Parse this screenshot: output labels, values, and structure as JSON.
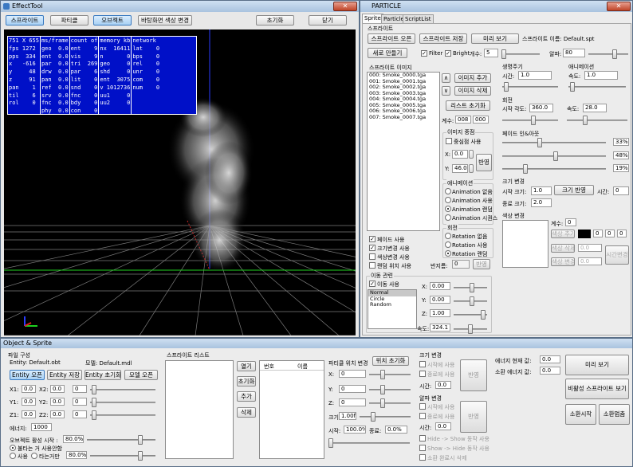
{
  "effect_tool": {
    "title": "EffectTool",
    "close": "✕",
    "toolbar": {
      "sprite": "스프라이트",
      "particle": "파티클",
      "object": "오브젝트",
      "bg_color": "바탕화면 색상 변경",
      "reset": "초기화",
      "close": "닫기"
    },
    "stats": [
      [
        "751 X 655",
        "fps 1272",
        "pps  334",
        "x   -616",
        "y     48",
        "z     91",
        "pan    1",
        "til    6",
        "rol    0"
      ],
      [
        "ms/frame",
        "geo  0.0",
        "ent  0.0",
        "par  0.0",
        "drw  0.0",
        "pan  0.0",
        "ref  0.0",
        "srv  0.0",
        "fnc  0.0",
        "phy  0.0"
      ],
      [
        "count of",
        "ent    9",
        "vis    9",
        "tri  269",
        "par    6",
        "lit    0",
        "snd    0",
        "fnc    0",
        "bdy    0",
        "con    0"
      ],
      [
        "memory kb",
        "nx  16411",
        "n       0",
        "geo     0",
        "shd     0",
        "ent  3075",
        "v 1012736",
        "uu1     0",
        "uu2     0"
      ],
      [
        "network",
        "lat    0",
        "bps    0",
        "rel    0",
        "unr    0",
        "com    0",
        "num    0"
      ]
    ]
  },
  "particle": {
    "title": "PARTICLE",
    "close": "✕",
    "tabs": [
      "Sprite",
      "Particle",
      "ScriptList"
    ],
    "sprite_group": "스프라이트",
    "open_sprite": "스프라이트 오픈",
    "save_sprite": "스프라이트 저장",
    "preview": "미리 보기",
    "sprite_name_label": "스프라이트 이름:",
    "sprite_name": "Default.spt",
    "new": "새로 만들기",
    "filter": "Filter",
    "bright": "Bright",
    "count_label": "개수:",
    "count": "5",
    "alpha_label": "알파:",
    "alpha": "80",
    "image_group": "스프라이트 이미지",
    "images": [
      "000: Smoke_0000.tga",
      "001: Smoke_0001.tga",
      "002: Smoke_0002.tga",
      "003: Smoke_0003.tga",
      "004: Smoke_0004.tga",
      "005: Smoke_0005.tga",
      "006: Smoke_0006.tga",
      "007: Smoke_0007.tga"
    ],
    "up": "∧",
    "down": "∨",
    "add_image": "이미지 추가",
    "del_image": "이미지 삭제",
    "list_reset": "리스트 초기화",
    "count2_label": "계수:",
    "count2_a": "008",
    "count2_b": "000",
    "center_group": "이미지 중점",
    "center_use": "중심점 사용",
    "cx_label": "X:",
    "cx": "0.0",
    "cy_label": "Y:",
    "cy": "46.0",
    "apply": "반영",
    "anim_group": "애니메이션",
    "anim_opts": [
      "Animation 없음",
      "Animation 사용",
      "Animation 랜덤",
      "Animation 시퀀스"
    ],
    "rot_group": "회전",
    "rot_opts": [
      "Rotation 없음",
      "Rotation 사용",
      "Rotation 랜덤"
    ],
    "radius_label": "반지름:",
    "radius": "0",
    "radius_apply": "반영",
    "life_group": "생명주기",
    "life_time_label": "시간:",
    "life_time": "1.0",
    "anim2_group": "애니메이션",
    "anim2_speed_label": "속도:",
    "anim2_speed": "1.0",
    "rot2_group": "회전",
    "rot_start_label": "시작 각도:",
    "rot_start": "360.0",
    "rot_speed_label": "속도:",
    "rot_speed": "28.0",
    "fade_group": "페이드 인&아웃",
    "fade_pct": [
      "33%",
      "48%",
      "19%"
    ],
    "size_group": "크기 변경",
    "size_start_label": "시작 크기:",
    "size_start": "1.0",
    "size_apply": "크기 반영",
    "size_time_label": "시간:",
    "size_time": "0",
    "size_end_label": "종료 크기:",
    "size_end": "2.0",
    "color_group": "색상 변경",
    "color_count_label": "계수:",
    "color_count": "0",
    "color_add": "색상 추가",
    "color_del": "색상 삭제",
    "color_edit": "색상 변경",
    "color_vals": [
      "0",
      "0",
      "0"
    ],
    "color_v2": "0.0",
    "color_v3": "0.0",
    "time_change": "시간변경",
    "checks": [
      "페이드 사용",
      "크기변경 사용",
      "색상변경 사용",
      "랜덤 위치 사용"
    ],
    "move_group": "이동 관련",
    "move_use": "이동 사용",
    "move_list": [
      "Normal",
      "Circle",
      "Random"
    ],
    "mx_label": "X:",
    "mx": "0.00",
    "my_label": "Y:",
    "my": "0.00",
    "mz_label": "Z:",
    "mz": "1.00",
    "mspeed_label": "속도:",
    "mspeed": "324.1"
  },
  "object_sprite": {
    "title": "Object & Sprite",
    "file_group": "파일 구성",
    "entity_label": "Entity:",
    "entity": "Default.obt",
    "model_label": "모델:",
    "model": "Default.mdl",
    "entity_open": "Entity 오픈",
    "entity_save": "Entity 저장",
    "entity_reset": "Entity 초기화",
    "model_open": "모델 오픈",
    "x1_label": "X1:",
    "x1": "0.0",
    "x2_label": "X2:",
    "x2": "0.0",
    "x3": "0",
    "y1_label": "Y1:",
    "y1": "0.0",
    "y2_label": "Y2:",
    "y2": "0.0",
    "y3": "0",
    "z1_label": "Z1:",
    "z1": "0.0",
    "z2_label": "Z2:",
    "z2": "0.0",
    "z3": "0",
    "energy_label": "에너지:",
    "energy": "1000",
    "obj_active_label": "오브젝트 활성 시작 :",
    "obj_active": "80.0%",
    "burn_use": "불타는 거 사용안함",
    "use": "사용",
    "burn_only": "타는거만",
    "burn_pct": "80.0%",
    "sprite_list_group": "스프라이트 리스트",
    "open": "열기",
    "reset": "초기화",
    "add": "추가",
    "del": "삭제",
    "col_no": "번호",
    "col_name": "이름",
    "pos_group": "파티클 위치 변경",
    "pos_reset": "위치 초기화",
    "px_label": "X:",
    "px": "0",
    "py_label": "Y:",
    "py": "0",
    "pz_label": "Z:",
    "pz": "0",
    "size_label": "크기:",
    "size": "1.00f",
    "start_label": "시작:",
    "start": "100.0%",
    "end_label": "종료:",
    "end": "0.0%",
    "size_change_group": "크기 변경",
    "start_use": "시작에 사용",
    "end_use": "종료에 사용",
    "apply": "반영",
    "time_label": "시간:",
    "time": "0.0",
    "alpha_change_group": "알파 변경",
    "start_use2": "시작에 사용",
    "end_use2": "종료에 사용",
    "apply2": "반영",
    "time2_label": "시간:",
    "time2": "0.0",
    "hide_show": "Hide -> Show 동작 사용",
    "show_hide": "Show -> Hide 동작 사용",
    "remove_on_end": "소환 완료시 삭제",
    "energy_now_label": "에너지 현재 값:",
    "energy_now": "0.0",
    "summon_energy_label": "소환 에너지 값:",
    "summon_energy": "0.0",
    "preview": "미리 보기",
    "inactive_preview": "비활성 스프라이트 보기",
    "summon_start": "소환시작",
    "summon_stop": "소환멈춤"
  }
}
